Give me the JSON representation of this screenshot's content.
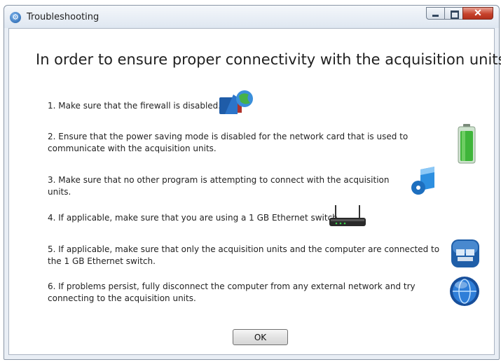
{
  "window": {
    "title": "Troubleshooting",
    "title_icon": "gear-icon",
    "controls": {
      "minimize": "minimize-icon",
      "maximize": "maximize-icon",
      "close_glyph": "✕"
    }
  },
  "content": {
    "heading": "In order to ensure proper connectivity with the acquisition units.",
    "steps": [
      {
        "text": "1. Make sure that the firewall is disabled.",
        "icon": "firewall-icon"
      },
      {
        "text": "2. Ensure that the power saving mode is disabled for the network card that is used to communicate with the acquisition units.",
        "icon": "battery-icon"
      },
      {
        "text": "3. Make sure that no other program is attempting to connect with the acquisition units.",
        "icon": "program-icon"
      },
      {
        "text": "4. If applicable, make sure that you are using a 1 GB Ethernet switch.",
        "icon": "router-icon"
      },
      {
        "text": "5. If applicable, make sure that only the acquisition units and the computer are connected to the 1 GB Ethernet switch.",
        "icon": "network-icon"
      },
      {
        "text": "6. If problems persist, fully disconnect the computer from any external network and try connecting to the acquisition units.",
        "icon": "globe-icon"
      }
    ],
    "ok_label": "OK"
  },
  "colors": {
    "title_bar": "#dfe7f1",
    "close_button": "#c7432c",
    "battery_green": "#3fb53a"
  }
}
